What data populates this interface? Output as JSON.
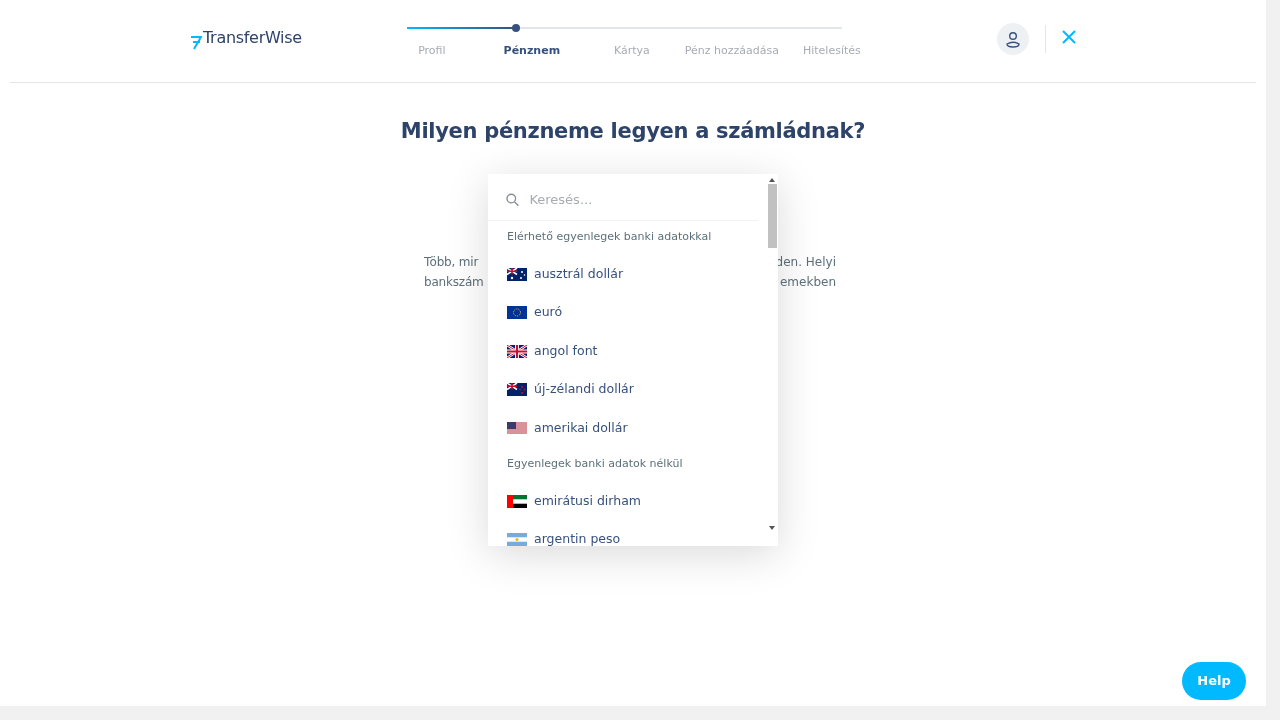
{
  "header": {
    "logo": "TransferWise",
    "progress": {
      "level": 0.25
    },
    "steps": [
      {
        "label": "Profil",
        "selected": false
      },
      {
        "label": "Pénznem",
        "selected": true
      },
      {
        "label": "Kártya",
        "selected": false
      },
      {
        "label": "Pénz hozzáadása",
        "selected": false
      },
      {
        "label": "Hitelesítés",
        "selected": false
      }
    ]
  },
  "title": "Milyen pénzneme legyen a számládnak?",
  "intro": {
    "left_lines": [
      "Több, mir",
      "bankszám"
    ],
    "right_lines": [
      "den. Helyi",
      "emekben"
    ]
  },
  "dropdown": {
    "search": {
      "placeholder": "Keresés..."
    },
    "groups": [
      {
        "heading": "Elérhető egyenlegek banki adatokkal",
        "items": [
          {
            "label": "ausztrál dollár"
          },
          {
            "label": "euró"
          },
          {
            "label": "angol font"
          },
          {
            "label": "új-zélandi dollár"
          },
          {
            "label": "amerikai dollár"
          }
        ]
      },
      {
        "heading": "Egyenlegek banki adatok nélkül",
        "items": [
          {
            "label": "emirátusi dirham"
          },
          {
            "label": "argentin peso"
          }
        ]
      }
    ]
  },
  "help_button": "Help"
}
